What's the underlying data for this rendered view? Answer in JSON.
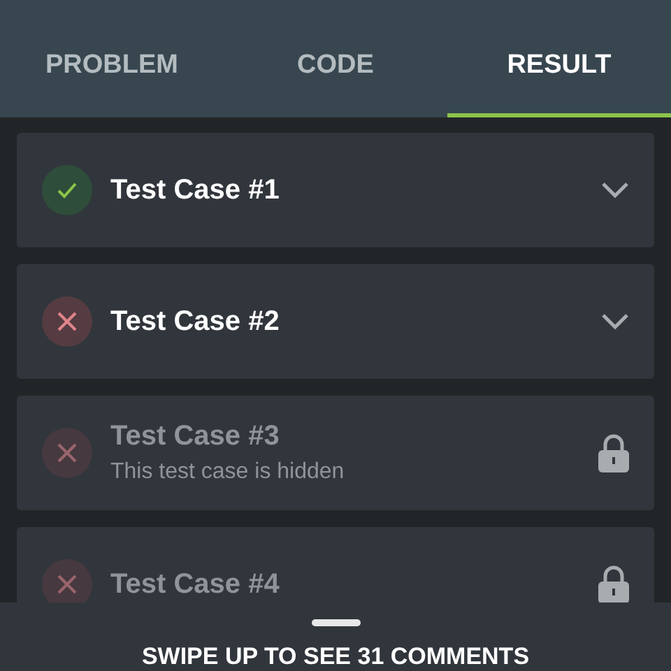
{
  "tabs": [
    {
      "label": "PROBLEM",
      "selected": false
    },
    {
      "label": "CODE",
      "selected": false
    },
    {
      "label": "RESULT",
      "selected": true
    }
  ],
  "test_cases": [
    {
      "title": "Test Case #1",
      "passed": true,
      "hidden": false
    },
    {
      "title": "Test Case #2",
      "passed": false,
      "hidden": false
    },
    {
      "title": "Test Case #3",
      "passed": false,
      "hidden": true,
      "subtitle": "This test case is hidden"
    },
    {
      "title": "Test Case #4",
      "passed": false,
      "hidden": true
    }
  ],
  "bottom_sheet": {
    "label": "SWIPE UP TO SEE 31 COMMENTS"
  }
}
